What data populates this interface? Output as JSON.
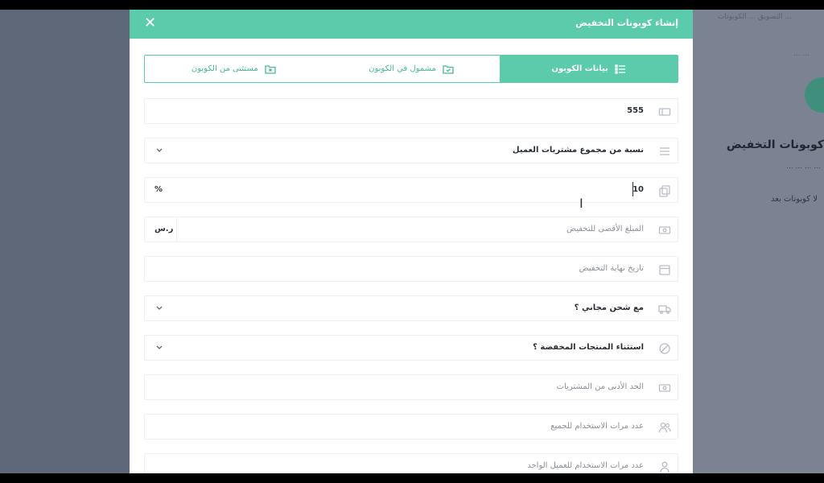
{
  "modal": {
    "title": "إنشاء كوبونات التخفيض",
    "close": "✕"
  },
  "tabs": [
    {
      "label": "بيانات الكوبون",
      "icon": "list-icon",
      "active": true
    },
    {
      "label": "مشمول في الكوبون",
      "icon": "folder-check-icon",
      "active": false
    },
    {
      "label": "مستثنى من الكوبون",
      "icon": "folder-x-icon",
      "active": false
    }
  ],
  "fields": {
    "code": {
      "value": "555",
      "icon": "ticket-icon"
    },
    "discount_type": {
      "value": "نسبة من مجموع مشتريات العميل",
      "icon": "list-lines-icon"
    },
    "discount_value": {
      "value": "10",
      "suffix": "%",
      "icon": "copy-icon"
    },
    "max_discount": {
      "placeholder": "المبلغ الأقصى للتخفيض",
      "suffix": "ر.س",
      "icon": "money-icon"
    },
    "end_date": {
      "placeholder": "تاريخ نهاية التخفيض",
      "icon": "calendar-icon"
    },
    "free_shipping": {
      "value": "مع شحن مجاني ؟",
      "icon": "truck-icon"
    },
    "exclude_discounted": {
      "value": "استثناء المنتجات المخفضة ؟",
      "icon": "ban-icon"
    },
    "min_purchase": {
      "placeholder": "الحد الأدنى من المشتريات",
      "icon": "money2-icon"
    },
    "usage_total": {
      "placeholder": "عدد مرات الاستخدام للجميع",
      "icon": "users-icon"
    },
    "usage_per_customer": {
      "placeholder": "عدد مرات الاستخدام للعميل الواحد",
      "icon": "user-icon"
    }
  },
  "background": {
    "topline": "... التسويق ... الكوبونات",
    "small": "... ...",
    "title": "كوبونات التخفيض",
    "subtitle": "... ... ... ...",
    "empty": "لا كوبونات بعد"
  },
  "colors": {
    "accent": "#5bcbab",
    "overlay": "#5e6878"
  }
}
